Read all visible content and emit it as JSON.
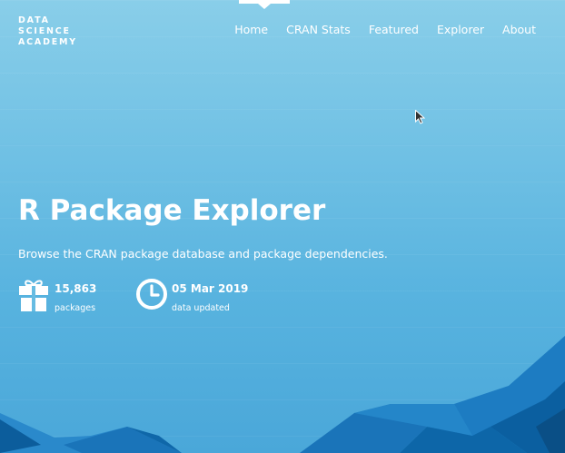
{
  "brand": {
    "lines": [
      "DATA",
      "SCIENCE",
      "ACADEMY"
    ]
  },
  "nav": {
    "items": [
      "Home",
      "CRAN Stats",
      "Featured",
      "Explorer",
      "About"
    ],
    "active": "Home"
  },
  "hero": {
    "title": "R Package Explorer",
    "subtitle": "Browse the CRAN package database and package dependencies."
  },
  "stats": {
    "packages": {
      "value": "15,863",
      "label": "packages",
      "icon": "gift-icon"
    },
    "updated": {
      "value": "05 Mar 2019",
      "label": "data updated",
      "icon": "clock-icon"
    }
  },
  "colors": {
    "sky_top": "#89cee9",
    "sky_bottom": "#4aa7d9",
    "poly_dark": "#0b5fa0",
    "poly_mid": "#1d7cc2",
    "poly_light": "#3a98d6"
  }
}
